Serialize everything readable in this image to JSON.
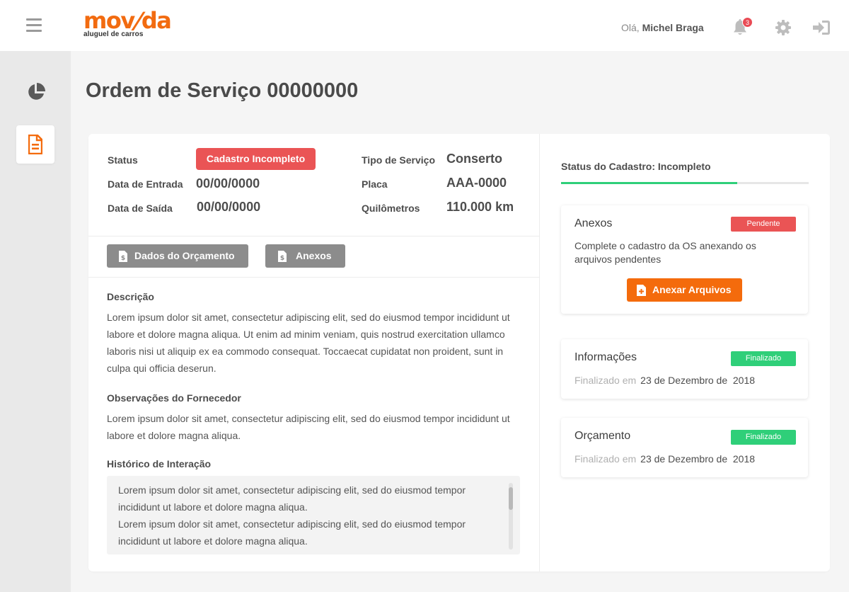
{
  "header": {
    "logo_word": "movida",
    "logo_tagline": "aluguel de carros",
    "greeting_prefix": "Olá,",
    "user_name": "Michel Braga",
    "notification_count": "3",
    "icons": [
      "menu-icon",
      "bell-icon",
      "gear-icon",
      "logout-icon"
    ]
  },
  "sidebar": {
    "items": [
      {
        "name": "dashboard",
        "icon": "pie-chart-icon",
        "active": false
      },
      {
        "name": "ordens",
        "icon": "document-icon",
        "active": true
      }
    ]
  },
  "page": {
    "title": "Ordem de Serviço 00000000"
  },
  "details": {
    "status_label": "Status",
    "status_value": "Cadastro Incompleto",
    "entry_label": "Data de Entrada",
    "entry_value": "00/00/0000",
    "exit_label": "Data de Saída",
    "exit_value": "00/00/0000",
    "service_type_label": "Tipo de Serviço",
    "service_type_value": "Conserto",
    "plate_label": "Placa",
    "plate_value": "AAA-0000",
    "km_label": "Quilômetros",
    "km_value": "110.000 km"
  },
  "tabs": [
    {
      "label": "Dados do Orçamento",
      "icon": "document-dollar-icon"
    },
    {
      "label": "Anexos",
      "icon": "document-dollar-icon"
    }
  ],
  "sections": {
    "description_title": "Descrição",
    "description_text": "Lorem ipsum dolor sit amet, consectetur adipiscing elit, sed do eiusmod tempor incididunt ut labore et dolore magna aliqua. Ut enim ad minim veniam, quis nostrud exercitation ullamco laboris nisi ut aliquip ex ea commodo consequat. Toccaecat cupidatat non proident, sunt in culpa qui officia deserun.",
    "supplier_title": "Observações do Fornecedor",
    "supplier_text": "Lorem ipsum dolor sit amet, consectetur adipiscing elit, sed do eiusmod tempor incididunt ut labore et dolore magna aliqua.",
    "history_title": "Histórico de Interação",
    "history_entries": [
      "Lorem ipsum dolor sit amet, consectetur adipiscing elit, sed do eiusmod tempor incididunt ut labore et dolore magna aliqua.",
      "Lorem ipsum dolor sit amet, consectetur adipiscing elit, sed do eiusmod tempor incididunt ut labore et dolore magna aliqua."
    ]
  },
  "registration": {
    "title": "Status do Cadastro: Incompleto",
    "progress_fraction": 0.71,
    "cards": [
      {
        "title": "Anexos",
        "badge": "Pendente",
        "badge_color": "#ea5455",
        "message": "Complete o cadastro da OS anexando os arquivos pendentes",
        "button_label": "Anexar Arquivos"
      },
      {
        "title": "Informações",
        "badge": "Finalizado",
        "badge_color": "#2fcf79",
        "finished_prefix": "Finalizado em",
        "finished_date": "23 de Dezembro de  2018"
      },
      {
        "title": "Orçamento",
        "badge": "Finalizado",
        "badge_color": "#2fcf79",
        "finished_prefix": "Finalizado em",
        "finished_date": "23 de Dezembro de  2018"
      }
    ]
  },
  "colors": {
    "brand_orange": "#f26b10",
    "status_red": "#ea5455",
    "status_green": "#2fcf79",
    "tab_gray": "#8c8c8c"
  }
}
